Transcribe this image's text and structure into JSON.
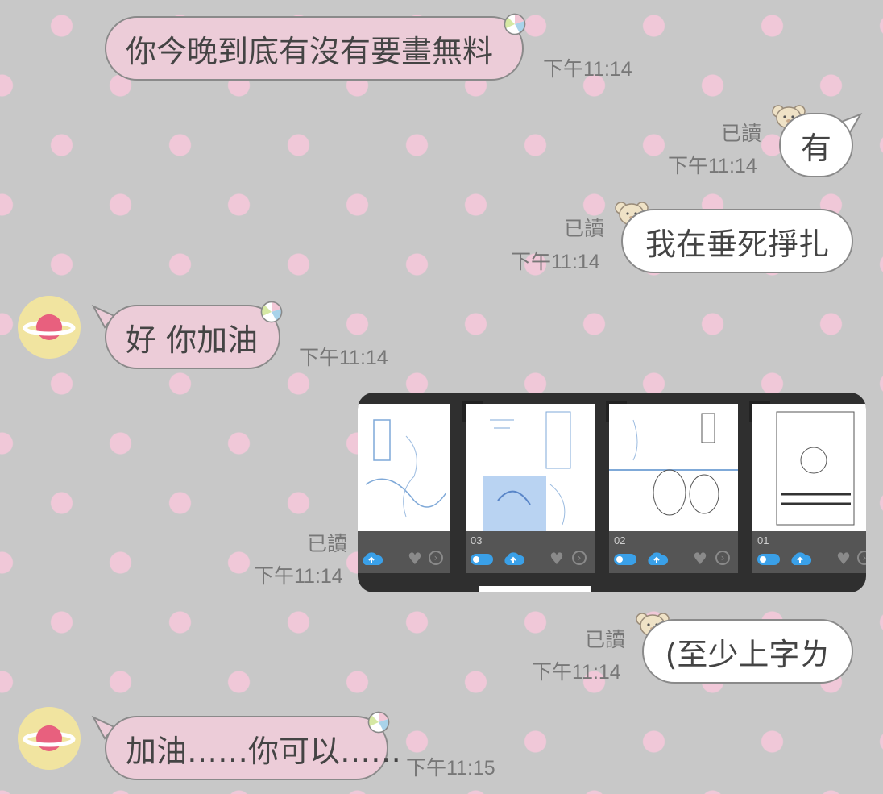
{
  "messages": [
    {
      "side": "in",
      "text": "你今晚到底有沒有要畫無料",
      "time": "下午11:14"
    },
    {
      "side": "out",
      "text": "有",
      "read": "已讀",
      "time": "下午11:14"
    },
    {
      "side": "out",
      "text": "我在垂死掙扎",
      "read": "已讀",
      "time": "下午11:14"
    },
    {
      "side": "in",
      "text": "好 你加油",
      "time": "下午11:14"
    },
    {
      "side": "out",
      "type": "image",
      "read": "已讀",
      "time": "下午11:14",
      "image": {
        "page_labels": [
          "03",
          "02",
          "01"
        ]
      }
    },
    {
      "side": "out",
      "text": "(至少上字ㄌ",
      "read": "已讀",
      "time": "下午11:14"
    },
    {
      "side": "in",
      "text": "加油……你可以……",
      "time": "下午11:15"
    }
  ],
  "icons": {
    "incoming_sticker": "beach-ball-icon",
    "outgoing_sticker": "bear-face-icon",
    "avatar": "planet-icon"
  },
  "colors": {
    "background": "#c8c8c8",
    "dots": "#f0c8d8",
    "incoming_bubble": "#ecccd8",
    "outgoing_bubble": "#ffffff",
    "avatar_bg": "#f1e4a0",
    "planet": "#e8607e"
  }
}
